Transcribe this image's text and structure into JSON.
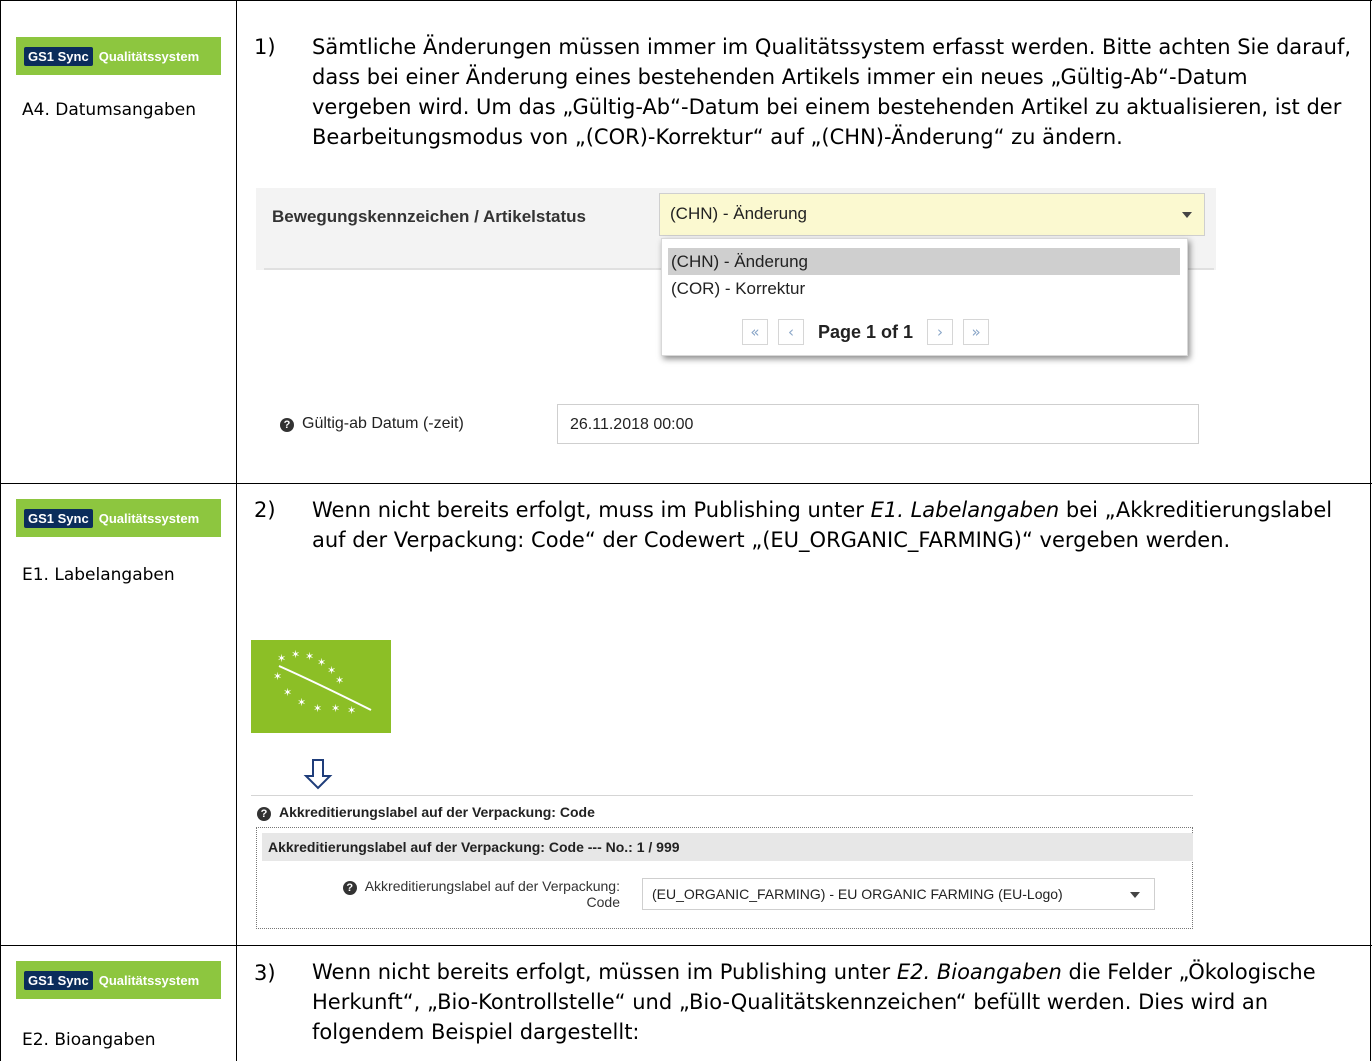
{
  "badge": {
    "sync": "GS1 Sync",
    "quality": "Qualitätssystem"
  },
  "rows": [
    {
      "section": "A4. Datumsangaben",
      "number": "1)",
      "text": "Sämtliche Änderungen müssen immer im Qualitätssystem erfasst werden. Bitte achten Sie darauf, dass bei einer Änderung eines bestehenden Artikels immer ein neues „Gültig-Ab“-Datum vergeben wird. Um das „Gültig-Ab“-Datum bei einem bestehenden Artikel zu aktualisieren, ist der Bearbeitungsmodus von „(COR)-Korrektur“ auf „(CHN)-Änderung“ zu ändern."
    },
    {
      "section": "E1. Labelangaben",
      "number": "2)",
      "text_before": "Wenn nicht bereits erfolgt, muss im Publishing unter ",
      "text_em": "E1. Labelangaben",
      "text_after": " bei „Akkreditierungslabel auf der Verpackung: Code“ der Codewert „(EU_ORGANIC_FARMING)“ vergeben werden."
    },
    {
      "section": "E2. Bioangaben",
      "number": "3)",
      "text_before": "Wenn nicht bereits erfolgt, müssen im Publishing unter ",
      "text_em": "E2. Bioangaben",
      "text_after": " die Felder „Ökologische Herkunft“, „Bio-Kontrollstelle“ und „Bio-Qualitätskennzeichen“ befüllt werden. Dies wird an folgendem Beispiel dargestellt:"
    }
  ],
  "status_form": {
    "label": "Bewegungskennzeichen / Artikelstatus",
    "value": "(CHN) - Änderung",
    "options": [
      "(CHN) - Änderung",
      "(COR) - Korrektur"
    ],
    "pager": {
      "first": "«",
      "prev": "‹",
      "info": "Page 1 of 1",
      "next": "›",
      "last": "»"
    },
    "date_label": "Gültig-ab Datum (-zeit)",
    "date_value": "26.11.2018 00:00"
  },
  "label_form": {
    "heading": "Akkreditierungslabel auf der Verpackung: Code",
    "bar": "Akkreditierungslabel auf der Verpackung: Code --- No.: 1 / 999",
    "field_label": "Akkreditierungslabel auf der Verpackung: Code",
    "field_value": "(EU_ORGANIC_FARMING) - EU ORGANIC FARMING (EU-Logo)"
  },
  "icons": {
    "help": "question-circle-icon",
    "dropdown": "caret-down-icon",
    "arrow": "arrow-down-icon",
    "logo": "eu-organic-logo"
  },
  "colors": {
    "badge_green": "#8dc63f",
    "badge_navy": "#0b2d5b",
    "eu_green": "#8cbf26",
    "select_highlight": "#fbf9d0"
  }
}
